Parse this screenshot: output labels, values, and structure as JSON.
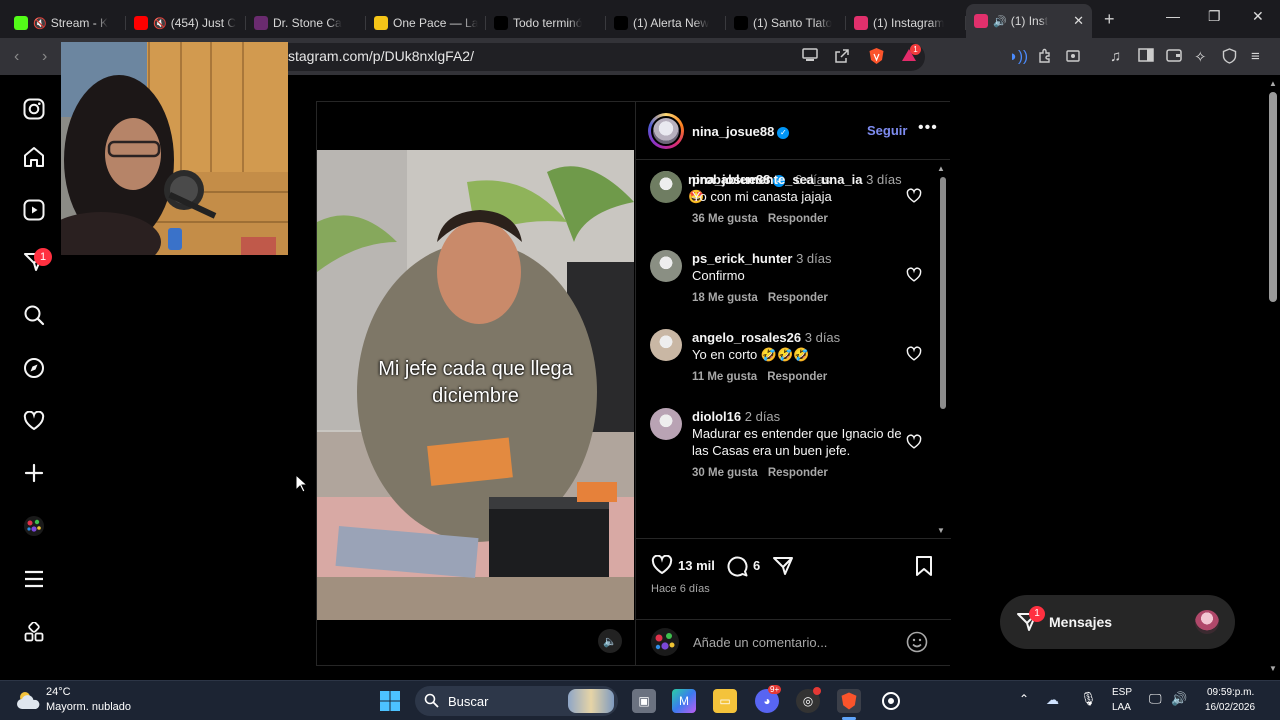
{
  "browser": {
    "tabs": [
      {
        "title": "Stream - K",
        "icon": "kick-icon",
        "color": "#53fc18",
        "muted": true
      },
      {
        "title": "(454) Just C",
        "icon": "youtube-icon",
        "color": "#ff0000",
        "muted": true
      },
      {
        "title": "Dr. Stone Ca",
        "icon": "crunchyroll-icon",
        "color": "#6a2b6f",
        "muted": false
      },
      {
        "title": "One Pace — La",
        "icon": "straw-hat-icon",
        "color": "#f5c518",
        "muted": false
      },
      {
        "title": "Todo terminó",
        "icon": "tiktok-icon",
        "color": "#000000",
        "muted": false
      },
      {
        "title": "(1) Alerta New",
        "icon": "x-icon",
        "color": "#000000",
        "muted": false
      },
      {
        "title": "(1) Santo Tlato",
        "icon": "x-icon",
        "color": "#000000",
        "muted": false
      },
      {
        "title": "(1) Instagram",
        "icon": "instagram-icon",
        "color": "#e1306c",
        "muted": false
      },
      {
        "title": "(1) Inst",
        "icon": "instagram-icon",
        "color": "#e1306c",
        "muted": false,
        "active": true
      }
    ],
    "url": "stagram.com/p/DUk8nxlgFA2/",
    "shields_badge": "1"
  },
  "sidebar": {
    "items": [
      {
        "icon": "instagram-logo-icon"
      },
      {
        "icon": "home-icon"
      },
      {
        "icon": "reels-icon"
      },
      {
        "icon": "messages-icon",
        "badge": "1"
      },
      {
        "icon": "search-icon"
      },
      {
        "icon": "explore-icon"
      },
      {
        "icon": "notifications-heart-icon"
      },
      {
        "icon": "create-plus-icon"
      },
      {
        "icon": "profile-avatar-icon"
      },
      {
        "icon": "more-menu-icon"
      },
      {
        "icon": "also-from-meta-icon"
      }
    ]
  },
  "post": {
    "video_caption_line1": "Mi jefe cada que llega",
    "video_caption_line2": "diciembre",
    "author": "nina_josue88",
    "follow_label": "Seguir",
    "caption": {
      "user": "nina_josue88",
      "time": "6 días",
      "text": "🤩"
    },
    "comments": [
      {
        "user": "probablemente_sea_una_ia",
        "time": "3 días",
        "text": "Yo con mi canasta jajaja",
        "likes": "36 Me gusta",
        "reply": "Responder"
      },
      {
        "user": "ps_erick_hunter",
        "time": "3 días",
        "text": "Confirmo",
        "likes": "18 Me gusta",
        "reply": "Responder"
      },
      {
        "user": "angelo_rosales26",
        "time": "3 días",
        "text": "Yo en corto 🤣🤣🤣",
        "likes": "11 Me gusta",
        "reply": "Responder"
      },
      {
        "user": "diolol16",
        "time": "2 días",
        "text": "Madurar es entender que Ignacio de las Casas era un buen jefe.",
        "likes": "30 Me gusta",
        "reply": "Responder"
      }
    ],
    "like_count": "13 mil",
    "comment_count": "6",
    "posted": "Hace 6 días",
    "add_comment_placeholder": "Añade un comentario..."
  },
  "messages": {
    "label": "Mensajes",
    "badge": "1"
  },
  "taskbar": {
    "weather_temp": "24°C",
    "weather_desc": "Mayorm. nublado",
    "search_label": "Buscar",
    "lang_line1": "ESP",
    "lang_line2": "LAA",
    "time": "09:59:p.m.",
    "date": "16/02/2026",
    "discord_badge": "9+"
  }
}
